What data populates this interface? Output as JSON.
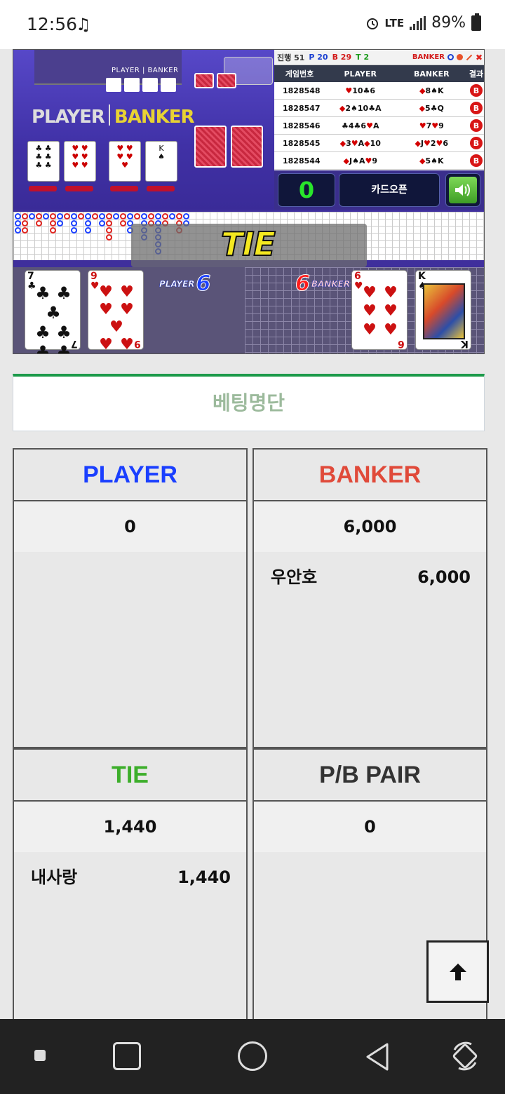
{
  "status_bar": {
    "time": "12:56",
    "note_glyph": "♫",
    "network": "LTE",
    "battery": "89%"
  },
  "game": {
    "mini_label": "PLAYER | BANKER",
    "big_player": "PLAYER",
    "big_banker": "BANKER",
    "results": {
      "progress_label": "진행 51",
      "p_count": "P 20",
      "b_count": "B 29",
      "t_count": "T 2",
      "banker_label": "BANKER",
      "columns": [
        "게임번호",
        "PLAYER",
        "BANKER",
        "결과"
      ],
      "rows": [
        {
          "num": "1828548",
          "player": "♥10♣6",
          "banker": "◆8♠K",
          "result": "B"
        },
        {
          "num": "1828547",
          "player": "◆2♠10♣A",
          "banker": "◆5♣Q",
          "result": "B"
        },
        {
          "num": "1828546",
          "player": "♣4♣6♥A",
          "banker": "♥7♥9",
          "result": "B"
        },
        {
          "num": "1828545",
          "player": "◆3♥A◆10",
          "banker": "◆J♥2♥6",
          "result": "B"
        },
        {
          "num": "1828544",
          "player": "◆J♠A♥9",
          "banker": "◆5♠K",
          "result": "B"
        }
      ]
    },
    "timer": "0",
    "card_open_label": "카드오픈",
    "overlay_text": "TIE",
    "player_label": "PLAYER",
    "player_score": "6",
    "banker_label": "BANKER",
    "banker_score": "6",
    "player_cards": [
      {
        "rank": "7",
        "suit": "♣"
      },
      {
        "rank": "9",
        "suit": "♥"
      }
    ],
    "banker_cards": [
      {
        "rank": "6",
        "suit": "♥"
      },
      {
        "rank": "K",
        "suit": "♠"
      }
    ]
  },
  "betting": {
    "title": "베팅명단",
    "player": {
      "label": "PLAYER",
      "color": "#1a3fff",
      "total": "0",
      "entries": []
    },
    "banker": {
      "label": "BANKER",
      "color": "#e04a3a",
      "total": "6,000",
      "entries": [
        {
          "name": "우안호",
          "amount": "6,000"
        }
      ]
    },
    "tie": {
      "label": "TIE",
      "color": "#3cae2a",
      "total": "1,440",
      "entries": [
        {
          "name": "내사랑",
          "amount": "1,440"
        }
      ]
    },
    "pair": {
      "label": "P/B PAIR",
      "color": "#333333",
      "total": "0",
      "entries": []
    }
  },
  "icons": {
    "scroll_top": "arrow-up-icon",
    "nav": [
      "dot-icon",
      "recent-apps-icon",
      "home-icon",
      "back-icon",
      "rotate-icon"
    ]
  }
}
